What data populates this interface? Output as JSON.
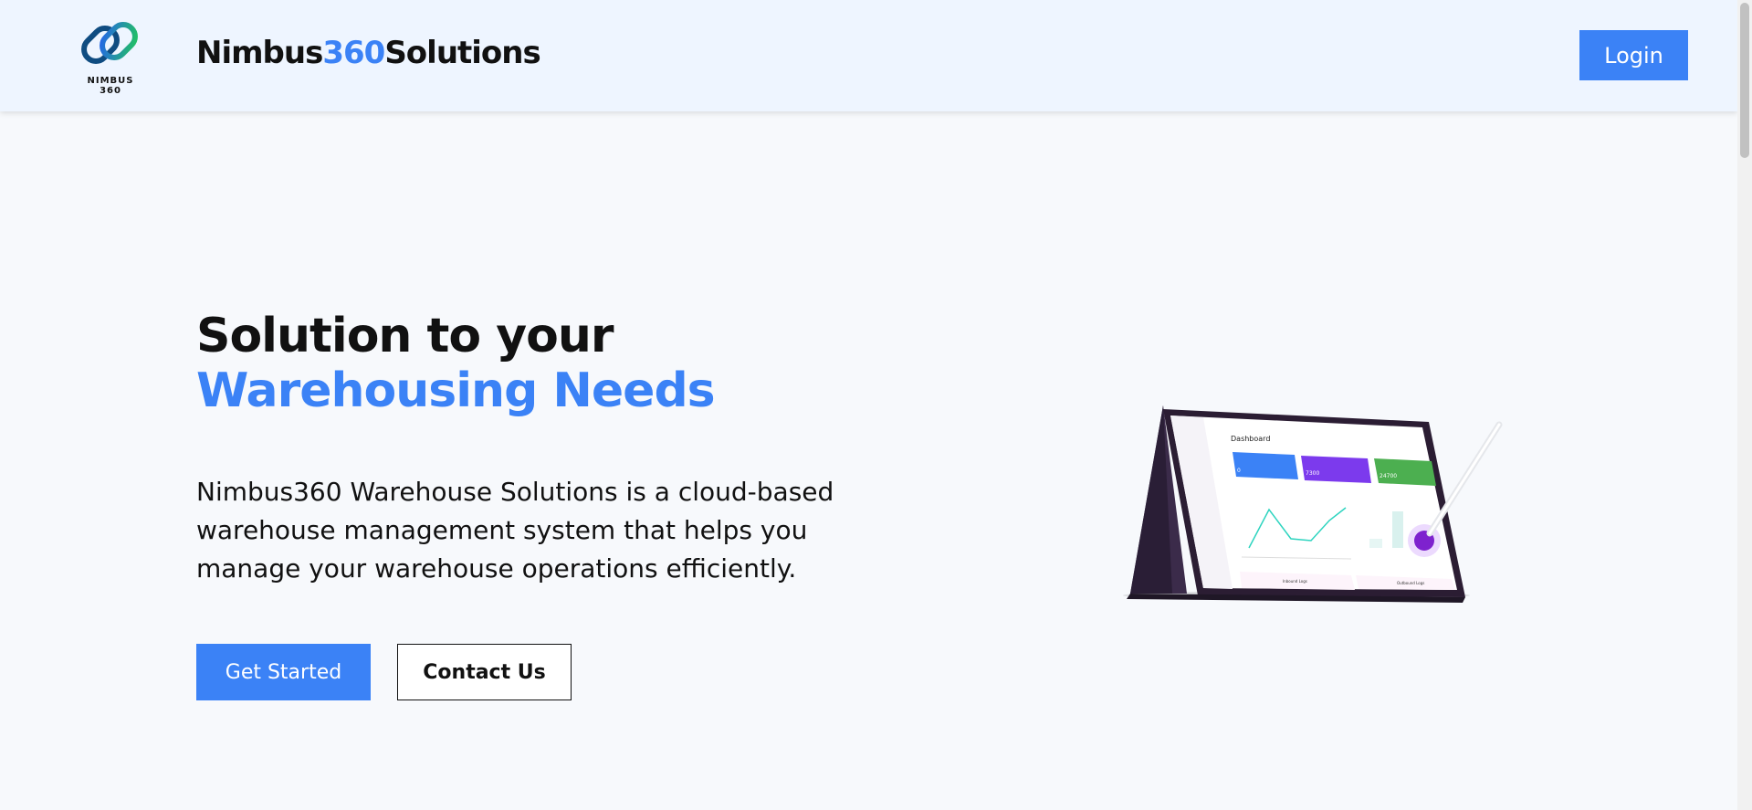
{
  "header": {
    "logo_caption": "NIMBUS 360",
    "brand_part1": "Nimbus",
    "brand_part2": "360",
    "brand_part3": "Solutions",
    "login_label": "Login"
  },
  "hero": {
    "headline_line1": "Solution to your",
    "headline_line2": "Warehousing Needs",
    "description": "Nimbus360 Warehouse Solutions is a cloud-based warehouse management system that helps you manage your warehouse operations efficiently.",
    "primary_button": "Get Started",
    "secondary_button": "Contact Us"
  },
  "illustration": {
    "dashboard_title": "Dashboard",
    "card1_value": "0",
    "card2_value": "7300",
    "card3_value": "24700",
    "panel1_title": "Inbound Logs",
    "panel2_title": "Outbound Logs"
  },
  "colors": {
    "accent": "#3b82f6",
    "header_bg": "#eef5ff",
    "page_bg": "#f7f9fc"
  },
  "icons": [
    "nimbus-logo-icon",
    "stylus-icon",
    "laptop-illustration"
  ]
}
